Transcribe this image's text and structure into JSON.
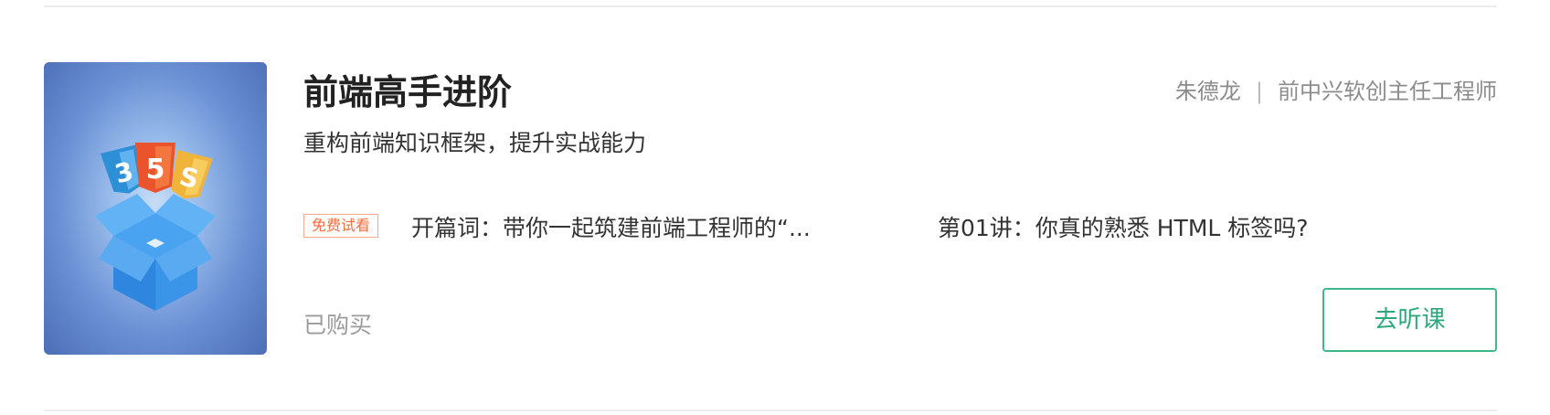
{
  "course": {
    "title": "前端高手进阶",
    "subtitle": "重构前端知识框架，提升实战能力",
    "author_name": "朱德龙",
    "author_separator": "|",
    "author_title": "前中兴软创主任工程师",
    "free_badge": "免费试看",
    "lessons": [
      {
        "label": "开篇词：带你一起筑建前端工程师的“..."
      },
      {
        "label": "第01讲：你真的熟悉 HTML 标签吗?"
      }
    ],
    "status": "已购买",
    "action_label": "去听课",
    "cover_badges": {
      "left": "3",
      "center": "5",
      "right": "S"
    }
  },
  "colors": {
    "accent_green": "#2ea87a",
    "badge_orange": "#f76d3c",
    "cover_blue": "#4c6eb7"
  }
}
